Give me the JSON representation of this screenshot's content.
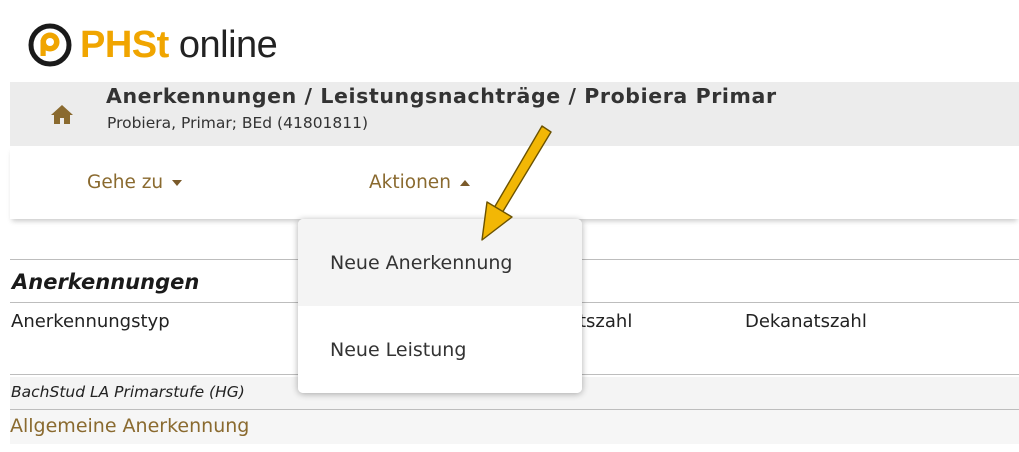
{
  "logo": {
    "text_brand": "PHSt",
    "text_rest": " online"
  },
  "header": {
    "icon": "home-icon",
    "title": "Anerkennungen / Leistungsnachträge  / Probiera Primar",
    "subtitle": "Probiera, Primar; BEd (41801811)"
  },
  "nav": {
    "goto_label": "Gehe zu",
    "goto_icon": "caret-down-icon",
    "actions_label": "Aktionen",
    "actions_icon": "caret-up-icon"
  },
  "dropdown": {
    "items": [
      {
        "label": "Neue Anerkennung"
      },
      {
        "label": "Neue Leistung"
      }
    ]
  },
  "section": {
    "title": "Anerkennungen",
    "columns": [
      "Anerkennungstyp",
      "tszahl",
      "Dekanatszahl"
    ],
    "group_label": "BachStud LA Primarstufe (HG)",
    "link_label": "Allgemeine Anerkennung"
  },
  "colors": {
    "brand": "#f0a500",
    "link": "#8a6a2f",
    "header_bg": "#ececec",
    "arrow": "#f2b705"
  }
}
